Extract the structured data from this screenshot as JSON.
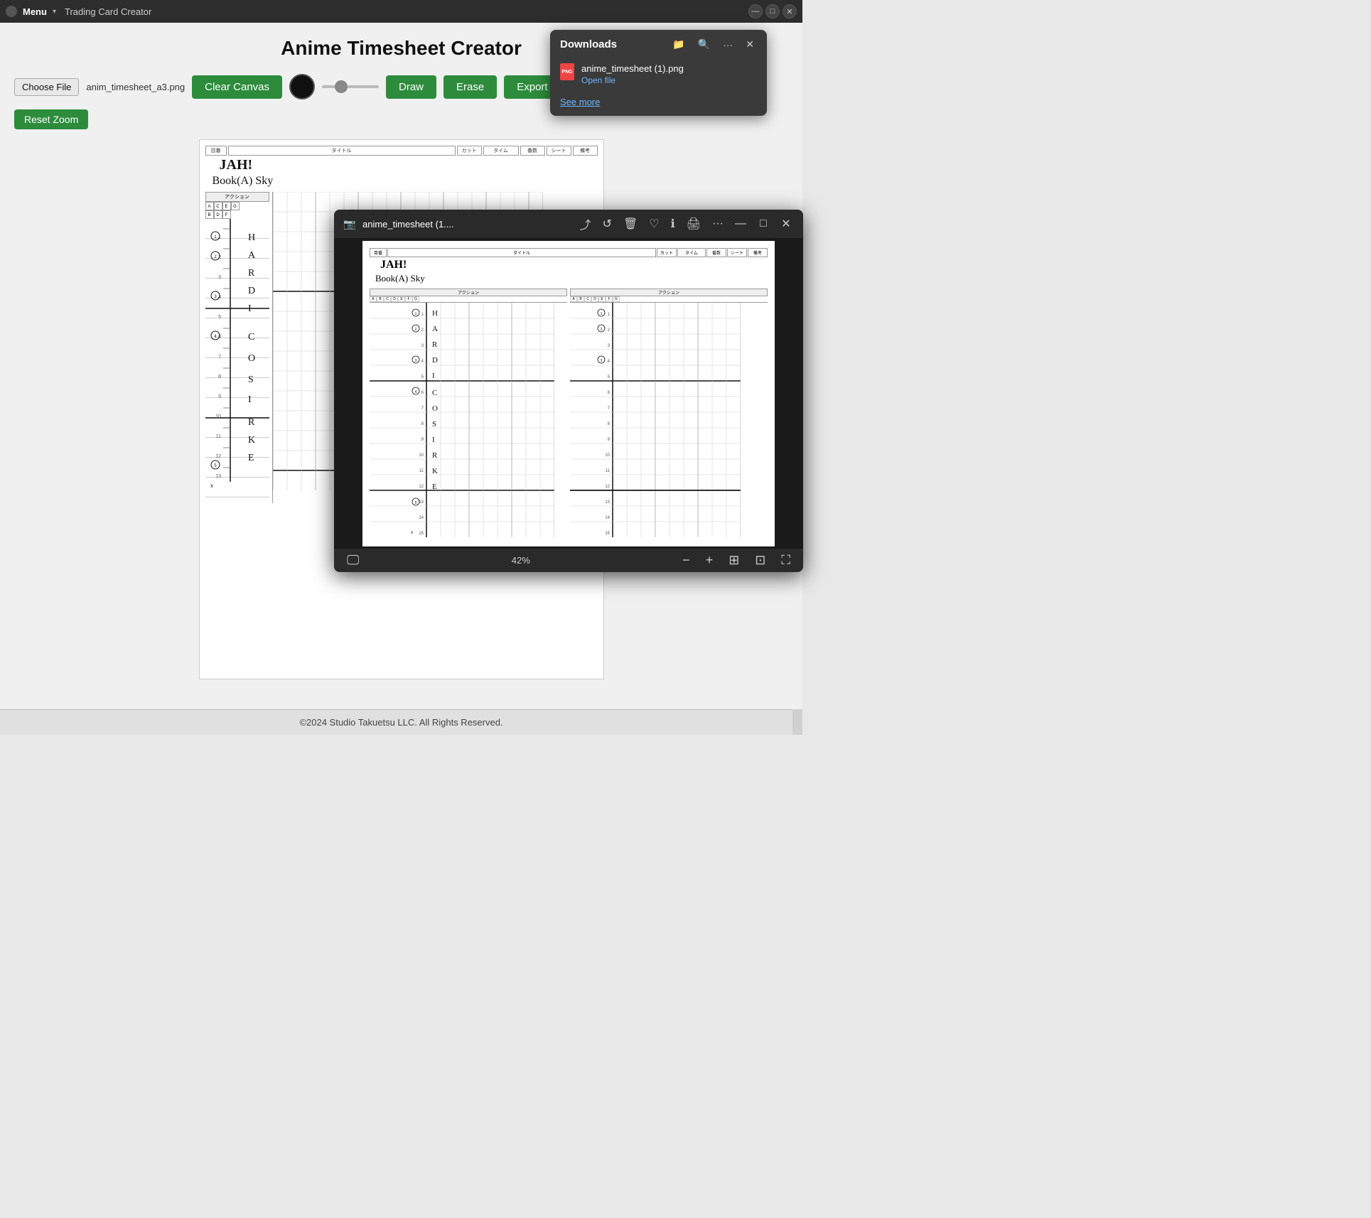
{
  "titleBar": {
    "appName": "Trading Card Creator",
    "menuLabel": "Menu",
    "chevron": "▾",
    "controls": [
      "—",
      "□",
      "✕"
    ]
  },
  "app": {
    "title": "Anime Timesheet Creator",
    "toolbar": {
      "chooseFileLabel": "Choose File",
      "fileName": "anim_timesheet_a3.png",
      "clearCanvasLabel": "Clear Canvas",
      "drawLabel": "Draw",
      "eraseLabel": "Erase",
      "exportLabel": "Export Ima...",
      "resetZoomLabel": "Reset Zoom",
      "colorSwatch": "#111111",
      "sliderValue": 30
    }
  },
  "downloads": {
    "title": "Downloads",
    "filename": "anime_timesheet (1).png",
    "openFileLabel": "Open file",
    "seeMoreLabel": "See more"
  },
  "imageViewer": {
    "filename": "anime_timesheet (1....",
    "zoomLevel": "42%",
    "windowControls": [
      "—",
      "□",
      "✕"
    ]
  },
  "canvasContent": {
    "text1": "JAH!",
    "text2": "Book(A) Sky"
  },
  "footer": {
    "copyright": "©2024 Studio Takuetsu LLC. All Rights Reserved."
  },
  "icons": {
    "menu": "≡",
    "folder": "📁",
    "search": "🔍",
    "ellipsis": "···",
    "close": "✕",
    "minimize": "—",
    "maximize": "□",
    "share": "⤴",
    "rotate": "↺",
    "trash": "🗑",
    "heart": "♡",
    "info": "ℹ",
    "print": "🖨",
    "monitor": "🖵",
    "zoomOut": "−",
    "zoomIn": "+",
    "fitScreen": "⊞",
    "slideshow": "⊡",
    "expand": "⛶",
    "camera": "📷"
  }
}
